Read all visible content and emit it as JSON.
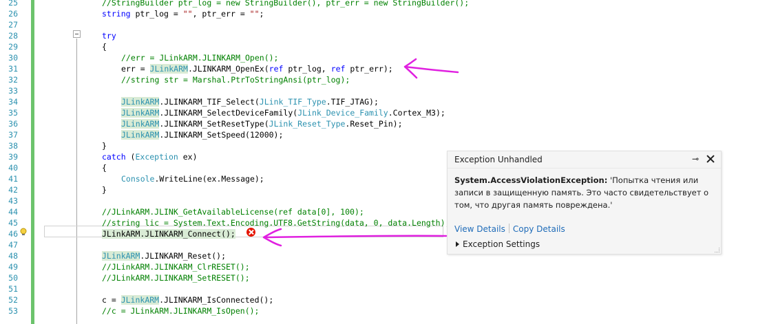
{
  "line_numbers": [
    "25",
    "26",
    "27",
    "28",
    "29",
    "30",
    "31",
    "32",
    "33",
    "34",
    "35",
    "36",
    "37",
    "38",
    "39",
    "40",
    "41",
    "42",
    "43",
    "44",
    "45",
    "46",
    "47",
    "48",
    "49",
    "50",
    "51",
    "52",
    "53"
  ],
  "code": {
    "l25": {
      "cm": "//StringBuilder ptr_log = new StringBuilder(), ptr_err = new StringBuilder();"
    },
    "l26": {
      "kw": "string",
      "rest": " ptr_log = ",
      "s1": "\"\"",
      "mid": ", ptr_err = ",
      "s2": "\"\"",
      "end": ";"
    },
    "l28": {
      "kw": "try"
    },
    "l29": {
      "t": "{"
    },
    "l30": {
      "cm": "//err = JLinkARM.JLINKARM_Open();"
    },
    "l31": {
      "a": "err = ",
      "cls": "JLinkARM",
      "b": ".JLINKARM_OpenEx(",
      "kw1": "ref",
      "c": " ptr_log, ",
      "kw2": "ref",
      "d": " ptr_err);"
    },
    "l32": {
      "cm": "//string str = Marshal.PtrToStringAnsi(ptr_log);"
    },
    "l34": {
      "cls": "JLinkARM",
      "b": ".JLINKARM_TIF_Select(",
      "cls2": "JLink_TIF_Type",
      "c": ".TIF_JTAG);"
    },
    "l35": {
      "cls": "JLinkARM",
      "b": ".JLINKARM_SelectDeviceFamily(",
      "cls2": "JLink_Device_Family",
      "c": ".Cortex_M3);"
    },
    "l36": {
      "cls": "JLinkARM",
      "b": ".JLINKARM_SetResetType(",
      "cls2": "JLink_Reset_Type",
      "c": ".Reset_Pin);"
    },
    "l37": {
      "cls": "JLinkARM",
      "b": ".JLINKARM_SetSpeed(12000);"
    },
    "l38": {
      "t": "}"
    },
    "l39": {
      "kw": "catch",
      "a": " (",
      "cls": "Exception",
      "b": " ex)"
    },
    "l40": {
      "t": "{"
    },
    "l41": {
      "cls": "Console",
      "b": ".WriteLine(ex.Message);"
    },
    "l42": {
      "t": "}"
    },
    "l44": {
      "cm": "//JLinkARM.JLINK_GetAvailableLicense(ref data[0], 100);"
    },
    "l45": {
      "cm": "//string lic = System.Text.Encoding.UTF8.GetString(data, 0, data.Length);"
    },
    "l46": {
      "t": "JLinkARM.JLINKARM_Connect();"
    },
    "l48": {
      "cls": "JLinkARM",
      "b": ".JLINKARM_Reset();"
    },
    "l49": {
      "cm": "//JLinkARM.JLINKARM_ClrRESET();"
    },
    "l50": {
      "cm": "//JLinkARM.JLINKARM_SetRESET();"
    },
    "l52": {
      "a": "c = ",
      "cls": "JLinkARM",
      "b": ".JLINKARM_IsConnected();"
    },
    "l53": {
      "cm": "//c = JLinkARM.JLINKARM_IsOpen();"
    }
  },
  "exception_popup": {
    "title": "Exception Unhandled",
    "pin_icon": "pin-icon",
    "exception_type": "System.AccessViolationException:",
    "message": " 'Попытка чтения или записи в защищенную память. Это часто свидетельствует о том, что другая память повреждена.'",
    "view_details": "View Details",
    "copy_details": "Copy Details",
    "settings": "Exception Settings"
  },
  "colors": {
    "keyword": "#0000ff",
    "type": "#2b91af",
    "comment": "#008000",
    "annotation_arrow": "#e020e0",
    "error": "#e51400"
  }
}
